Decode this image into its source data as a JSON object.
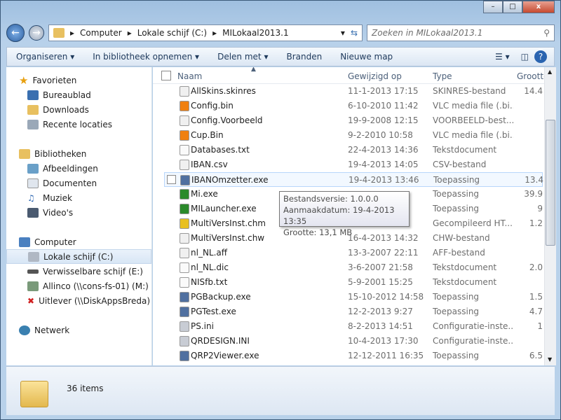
{
  "window": {
    "minimize": "–",
    "maximize": "□",
    "close": "x"
  },
  "address": {
    "parts": [
      "Computer",
      "Lokale schijf (C:)",
      "MILokaal2013.1"
    ],
    "search_placeholder": "Zoeken in MILokaal2013.1"
  },
  "toolbar": {
    "organize": "Organiseren",
    "library": "In bibliotheek opnemen",
    "share": "Delen met",
    "burn": "Branden",
    "new_folder": "Nieuwe map"
  },
  "sidebar": {
    "favorites": "Favorieten",
    "fav_items": [
      "Bureaublad",
      "Downloads",
      "Recente locaties"
    ],
    "libraries": "Bibliotheken",
    "lib_items": [
      "Afbeeldingen",
      "Documenten",
      "Muziek",
      "Video's"
    ],
    "computer": "Computer",
    "comp_items": [
      "Lokale schijf (C:)",
      "Verwisselbare schijf (E:)",
      "Allinco (\\\\cons-fs-01) (M:)",
      "Uitlever (\\\\DiskAppsBreda) (Z:)"
    ],
    "network": "Netwerk"
  },
  "columns": {
    "name": "Naam",
    "date": "Gewijzigd op",
    "type": "Type",
    "size": "Grootte"
  },
  "files": [
    {
      "name": "AllSkins.skinres",
      "date": "11-1-2013 17:15",
      "type": "SKINRES-bestand",
      "size": "14.4",
      "icon": "file-icon"
    },
    {
      "name": "Config.bin",
      "date": "6-10-2010 11:42",
      "type": "VLC media file (.bi...",
      "size": "",
      "icon": "vlc-icon"
    },
    {
      "name": "Config.Voorbeeld",
      "date": "19-9-2008 12:15",
      "type": "VOORBEELD-best...",
      "size": "",
      "icon": "file-icon"
    },
    {
      "name": "Cup.Bin",
      "date": "9-2-2010 10:58",
      "type": "VLC media file (.bi...",
      "size": "",
      "icon": "vlc-icon"
    },
    {
      "name": "Databases.txt",
      "date": "22-4-2013 14:36",
      "type": "Tekstdocument",
      "size": "",
      "icon": "text-file-icon"
    },
    {
      "name": "IBAN.csv",
      "date": "19-4-2013 14:05",
      "type": "CSV-bestand",
      "size": "",
      "icon": "file-icon"
    },
    {
      "name": "IBANOmzetter.exe",
      "date": "19-4-2013 13:46",
      "type": "Toepassing",
      "size": "13.4",
      "icon": "exe-icon"
    },
    {
      "name": "Mi.exe",
      "date": "",
      "type": "Toepassing",
      "size": "39.9",
      "icon": "app-icon"
    },
    {
      "name": "MILauncher.exe",
      "date": "",
      "type": "Toepassing",
      "size": "9",
      "icon": "app-icon"
    },
    {
      "name": "MultiVersInst.chm",
      "date": "",
      "type": "Gecompileerd HT...",
      "size": "1.2",
      "icon": "help-icon"
    },
    {
      "name": "MultiVersInst.chw",
      "date": "16-4-2013 14:32",
      "type": "CHW-bestand",
      "size": "",
      "icon": "file-icon"
    },
    {
      "name": "nl_NL.aff",
      "date": "13-3-2007 22:11",
      "type": "AFF-bestand",
      "size": "",
      "icon": "file-icon"
    },
    {
      "name": "nl_NL.dic",
      "date": "3-6-2007 21:58",
      "type": "Tekstdocument",
      "size": "2.0",
      "icon": "text-file-icon"
    },
    {
      "name": "NISfb.txt",
      "date": "5-9-2001 15:25",
      "type": "Tekstdocument",
      "size": "",
      "icon": "text-file-icon"
    },
    {
      "name": "PGBackup.exe",
      "date": "15-10-2012 14:58",
      "type": "Toepassing",
      "size": "1.5",
      "icon": "exe-icon"
    },
    {
      "name": "PGTest.exe",
      "date": "12-2-2013 9:27",
      "type": "Toepassing",
      "size": "4.7",
      "icon": "exe-icon"
    },
    {
      "name": "PS.ini",
      "date": "8-2-2013 14:51",
      "type": "Configuratie-inste...",
      "size": "1",
      "icon": "settings-file-icon"
    },
    {
      "name": "QRDESIGN.INI",
      "date": "10-4-2013 17:30",
      "type": "Configuratie-inste...",
      "size": "",
      "icon": "settings-file-icon"
    },
    {
      "name": "QRP2Viewer.exe",
      "date": "12-12-2011 16:35",
      "type": "Toepassing",
      "size": "6.5",
      "icon": "exe-icon"
    }
  ],
  "tooltip": {
    "version": "Bestandsversie: 1.0.0.0",
    "created": "Aanmaakdatum: 19-4-2013 13:35",
    "size": "Grootte: 13,1 MB"
  },
  "status": {
    "count": "36 items"
  }
}
